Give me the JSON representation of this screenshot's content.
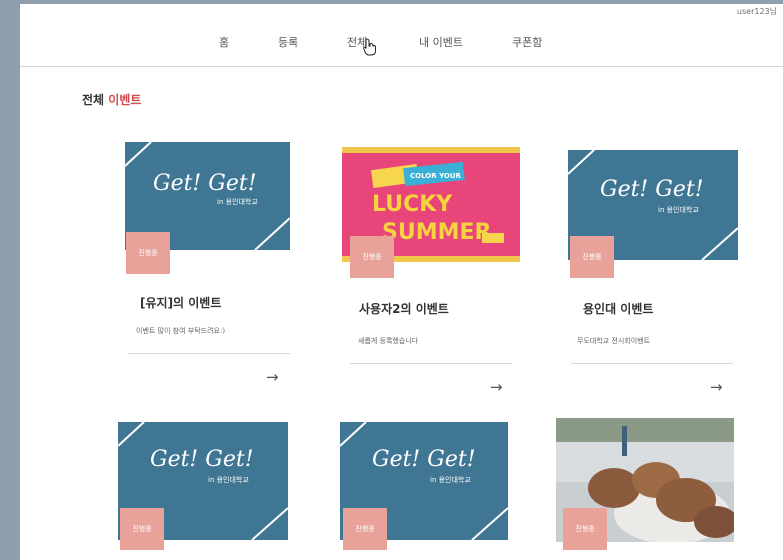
{
  "header": {
    "user": "user123님",
    "nav": [
      "홈",
      "등록",
      "전체",
      "내 이벤트",
      "쿠폰함"
    ]
  },
  "section": {
    "title_prefix": "전체",
    "title_accent": "이벤트",
    "accent_color": "#d14b4b"
  },
  "placeholder_art": {
    "brand": "Get! Get!",
    "sub": "in 용인대학교",
    "color": "#3f7693"
  },
  "poster": {
    "line1": "COLOR YOUR",
    "line2": "LUCKY",
    "line3": "SUMMER"
  },
  "events": [
    {
      "badge": "진행중",
      "title": "[유지]의 이벤트",
      "desc": "이벤트 많이 참여 부탁드려요:)",
      "arrow": "→"
    },
    {
      "badge": "진행중",
      "title": "사용자2의 이벤트",
      "desc": "새롭게 등록했습니다",
      "arrow": "→"
    },
    {
      "badge": "진행중",
      "title": "용인대 이벤트",
      "desc": "무도대학교 전시회이벤트",
      "arrow": "→"
    },
    {
      "badge": "진행중"
    },
    {
      "badge": "진행중"
    },
    {
      "badge": "진행중"
    }
  ],
  "badge_color": "#e9a29a"
}
